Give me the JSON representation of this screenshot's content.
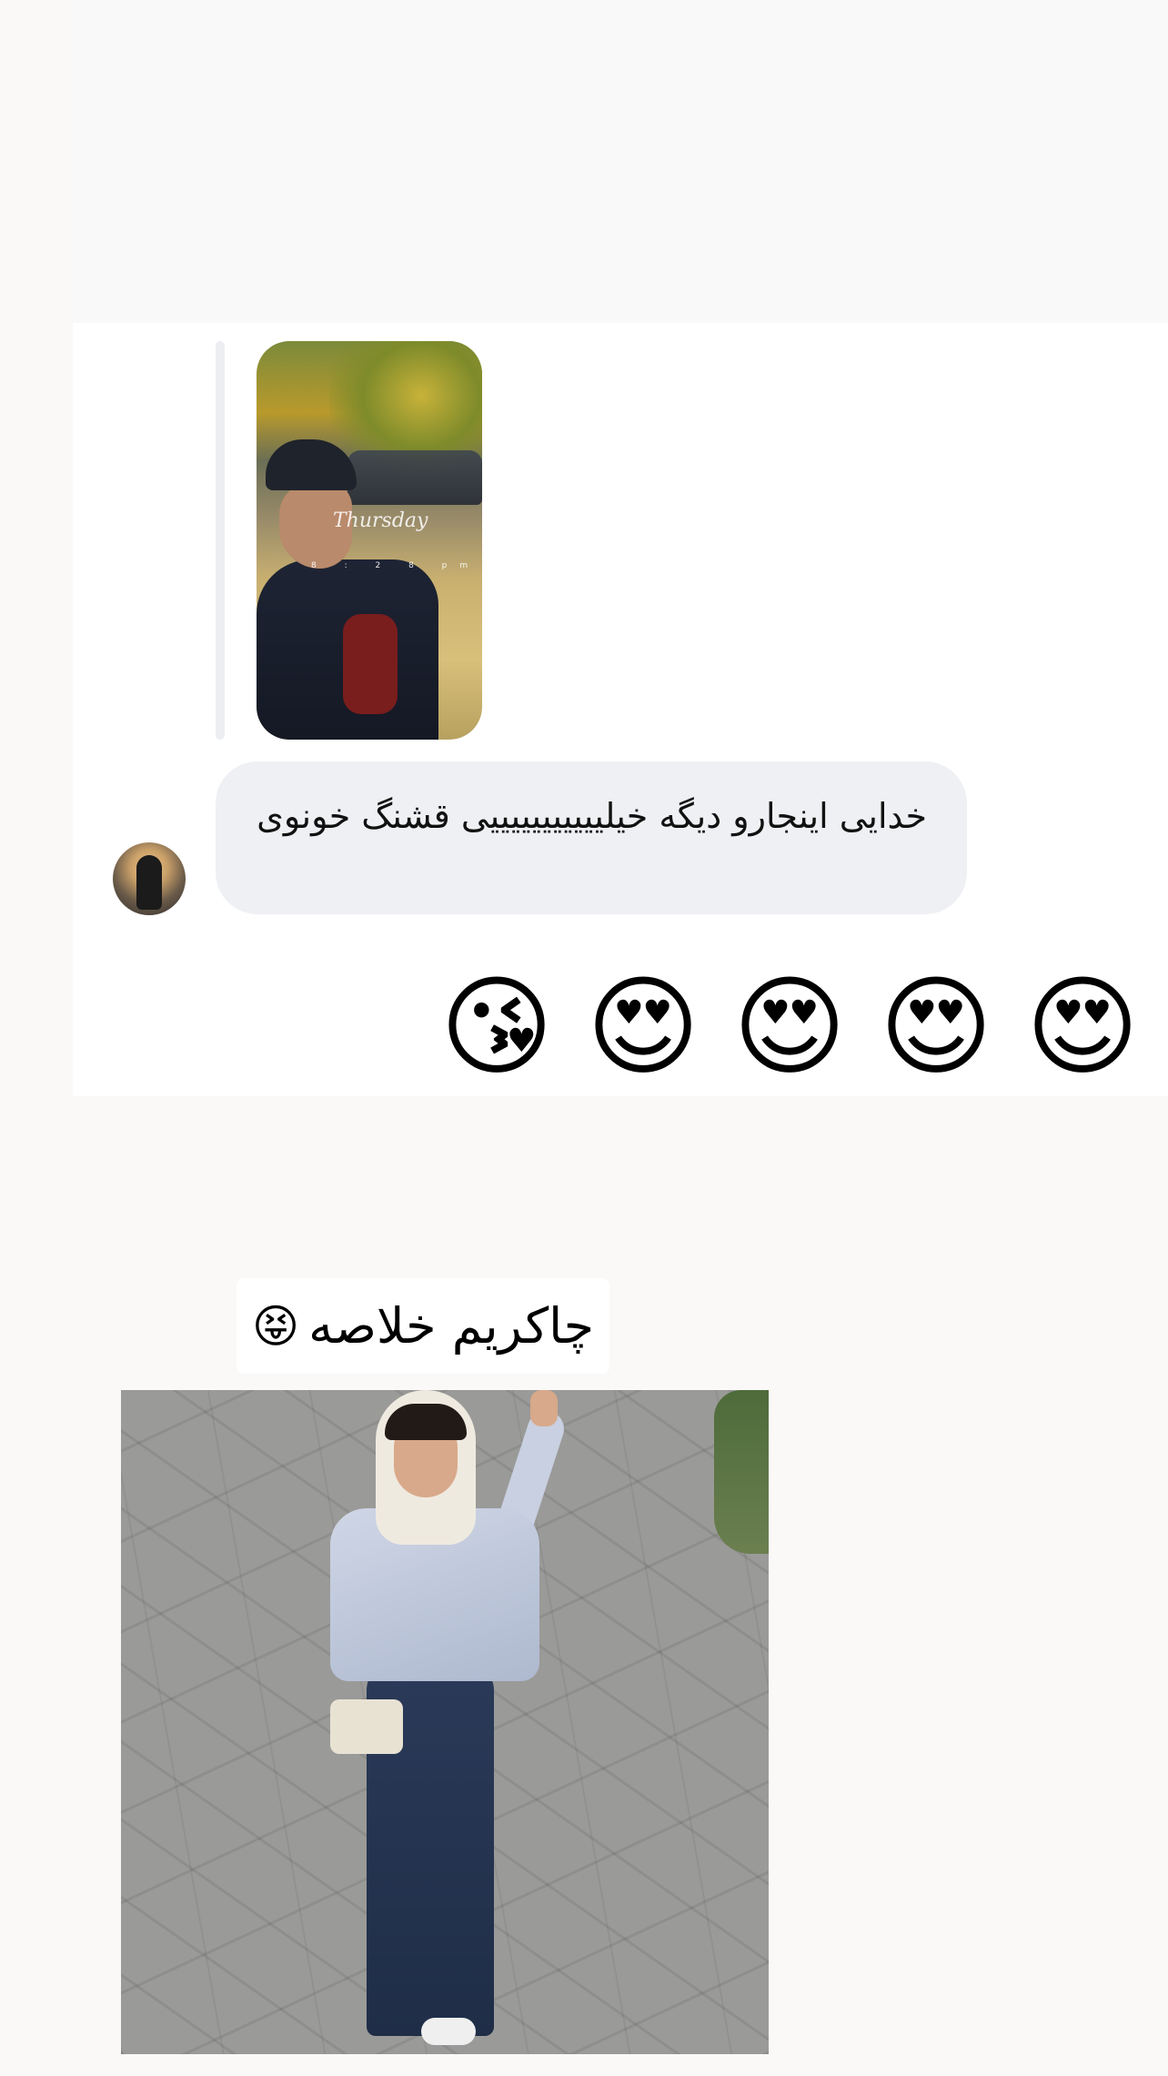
{
  "story_reply": {
    "thumbnail_label": "Thursday",
    "thumbnail_time": "8 : 2 8 pm"
  },
  "message": {
    "text": "خدایی اینجارو دیگه خیلیییییییییییی قشنگ خونوی"
  },
  "reactions": [
    "😘",
    "😍",
    "😍",
    "😍",
    "😍"
  ],
  "post": {
    "caption": "چاکریم خلاصه",
    "caption_emoji": "😝"
  }
}
